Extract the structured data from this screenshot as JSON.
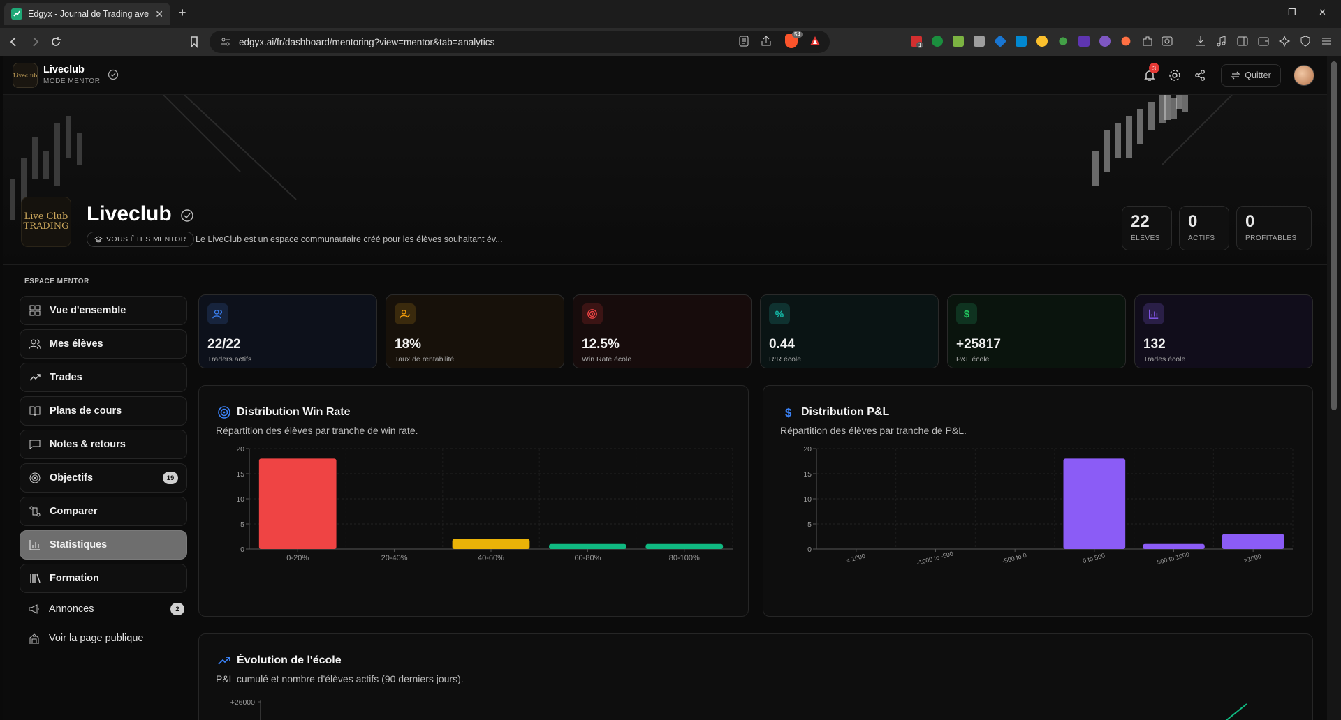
{
  "browser": {
    "tab_title": "Edgyx - Journal de Trading avec",
    "url": "edgyx.ai/fr/dashboard/mentoring?view=mentor&tab=analytics",
    "brave_count": "54",
    "ext_badge": "1"
  },
  "topbar": {
    "brand_name": "Liveclub",
    "brand_sub": "MODE MENTOR",
    "logo_text": "Liveclub",
    "notif_count": "3",
    "quit_label": "Quitter"
  },
  "hero": {
    "logo_line1": "Live Club",
    "logo_line2": "TRADING",
    "title": "Liveclub",
    "mentor_badge": "VOUS ÊTES MENTOR",
    "description": "Le LiveClub est un espace communautaire créé pour les élèves souhaitant év...",
    "stats": [
      {
        "value": "22",
        "label": "ÉLÈVES"
      },
      {
        "value": "0",
        "label": "ACTIFS"
      },
      {
        "value": "0",
        "label": "PROFITABLES"
      }
    ]
  },
  "sidebar": {
    "title": "ESPACE MENTOR",
    "items": [
      {
        "label": "Vue d'ensemble",
        "icon": "grid-icon"
      },
      {
        "label": "Mes élèves",
        "icon": "users-icon"
      },
      {
        "label": "Trades",
        "icon": "trend-icon"
      },
      {
        "label": "Plans de cours",
        "icon": "book-icon"
      },
      {
        "label": "Notes & retours",
        "icon": "message-icon"
      },
      {
        "label": "Objectifs",
        "icon": "target-icon",
        "badge": "19"
      },
      {
        "label": "Comparer",
        "icon": "compare-icon"
      },
      {
        "label": "Statistiques",
        "icon": "bar-chart-icon",
        "active": true
      },
      {
        "label": "Formation",
        "icon": "library-icon"
      }
    ],
    "extra": [
      {
        "label": "Annonces",
        "icon": "megaphone-icon",
        "badge": "2"
      },
      {
        "label": "Voir la page publique",
        "icon": "building-icon"
      }
    ]
  },
  "kpis": [
    {
      "value": "22/22",
      "label": "Traders actifs",
      "icon": "users-icon",
      "color": "#3b82f6"
    },
    {
      "value": "18%",
      "label": "Taux de rentabilité",
      "icon": "user-check-icon",
      "color": "#f59e0b"
    },
    {
      "value": "12.5%",
      "label": "Win Rate école",
      "icon": "target-icon",
      "color": "#ef4444"
    },
    {
      "value": "0.44",
      "label": "R:R école",
      "icon": "percent-icon",
      "color": "#14b8a6"
    },
    {
      "value": "+25817",
      "label": "P&L école",
      "icon": "dollar-icon",
      "color": "#22c55e"
    },
    {
      "value": "132",
      "label": "Trades école",
      "icon": "bar-chart-icon",
      "color": "#8b5cf6"
    }
  ],
  "panels": {
    "winrate": {
      "title": "Distribution Win Rate",
      "subtitle": "Répartition des élèves par tranche de win rate."
    },
    "pnl": {
      "title": "Distribution P&L",
      "subtitle": "Répartition des élèves par tranche de P&L."
    },
    "evolution": {
      "title": "Évolution de l'école",
      "subtitle": "P&L cumulé et nombre d'élèves actifs (90 derniers jours)."
    }
  },
  "chart_data": [
    {
      "type": "bar",
      "title": "Distribution Win Rate",
      "categories": [
        "0-20%",
        "20-40%",
        "40-60%",
        "60-80%",
        "80-100%"
      ],
      "values": [
        18,
        0,
        2,
        1,
        1
      ],
      "colors": [
        "#ef4444",
        "#ef4444",
        "#eab308",
        "#10b981",
        "#10b981"
      ],
      "ylim": [
        0,
        20
      ],
      "yticks": [
        0,
        5,
        10,
        15,
        20
      ],
      "grid": true
    },
    {
      "type": "bar",
      "title": "Distribution P&L",
      "categories": [
        "<-1000",
        "-1000 to -500",
        "-500 to 0",
        "0 to 500",
        "500 to 1000",
        ">1000"
      ],
      "values": [
        0,
        0,
        0,
        18,
        1,
        3
      ],
      "colors": [
        "#8b5cf6",
        "#8b5cf6",
        "#8b5cf6",
        "#8b5cf6",
        "#8b5cf6",
        "#8b5cf6"
      ],
      "ylim": [
        0,
        20
      ],
      "yticks": [
        0,
        5,
        10,
        15,
        20
      ],
      "grid": true
    },
    {
      "type": "line",
      "title": "Évolution de l'école",
      "ytick_top": "+26000"
    }
  ]
}
